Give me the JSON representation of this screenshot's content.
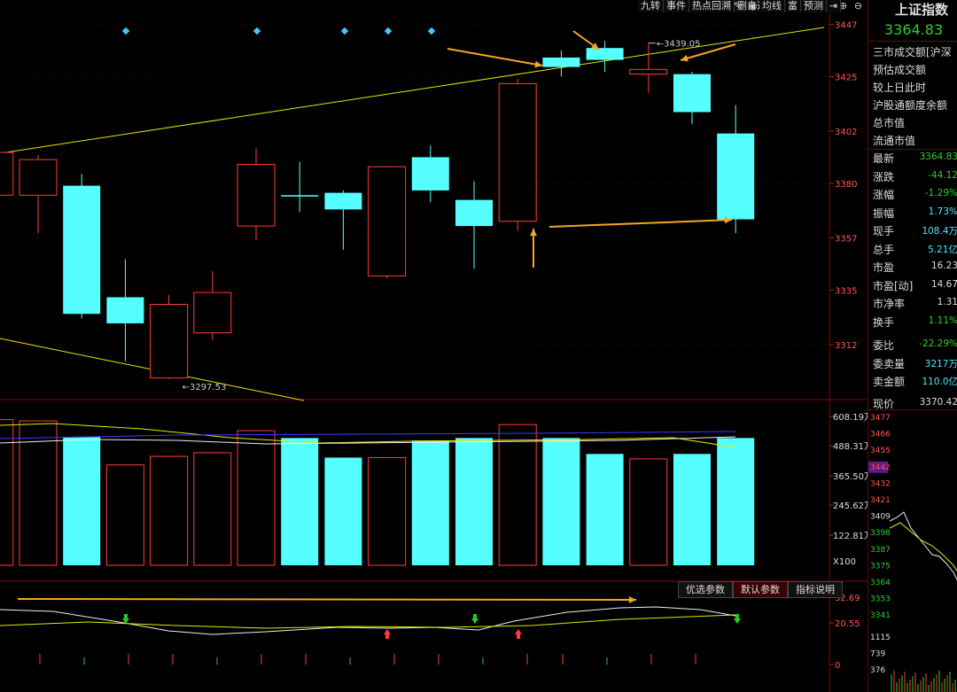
{
  "toolbar": {
    "items": [
      "九转",
      "事件",
      "热点回溯",
      "删自选",
      "均线",
      "富",
      "预测"
    ],
    "icons": [
      "pen-icon",
      "eye-icon",
      "hand-icon",
      "dotted-icon",
      "scissors-icon",
      "lock-icon",
      "delete-icon",
      "zoom-in-icon",
      "zoom-out-icon"
    ]
  },
  "right_panel": {
    "title": "上证指数",
    "price": "3364.83",
    "labels_top": [
      "三市成交额[沪深",
      "预估成交额",
      "较上日此时",
      "沪股通额度余额",
      "总市值",
      "流通市值"
    ],
    "quote_rows": [
      {
        "label": "最新",
        "value": "3364.83",
        "color": "green"
      },
      {
        "label": "涨跌",
        "value": "-44.12",
        "color": "green"
      },
      {
        "label": "涨幅",
        "value": "-1.29%",
        "color": "green"
      },
      {
        "label": "振幅",
        "value": "1.73%",
        "color": "cyan"
      },
      {
        "label": "现手",
        "value": "108.4万",
        "color": "cyan"
      },
      {
        "label": "总手",
        "value": "5.21亿",
        "color": "cyan"
      },
      {
        "label": "市盈",
        "value": "16.23",
        "color": "white"
      },
      {
        "label": "市盈[动]",
        "value": "14.67",
        "color": "white"
      },
      {
        "label": "市净率",
        "value": "1.31",
        "color": "white"
      },
      {
        "label": "换手",
        "value": "1.11%",
        "color": "green"
      },
      {
        "label": "委比",
        "value": "-22.29%",
        "color": "green"
      },
      {
        "label": "委卖量",
        "value": "3217万",
        "color": "cyan"
      },
      {
        "label": "卖金额",
        "value": "110.0亿",
        "color": "cyan"
      },
      {
        "label": "现价",
        "value": "3370.42",
        "color": "white"
      }
    ],
    "mini_axis": [
      "3477",
      "3466",
      "3455",
      "3442",
      "3432",
      "3421",
      "3409",
      "3398",
      "3387",
      "3375",
      "3364",
      "3353",
      "3341",
      "1115",
      "739",
      "376"
    ]
  },
  "param_tabs": [
    "优选参数",
    "默认参数",
    "指标说明"
  ],
  "colors": {
    "up": "#ff3b3b",
    "down": "#55ffff",
    "ma": "#e6e600",
    "arrow": "#f5a623"
  },
  "chart_data": [
    {
      "type": "candlestick",
      "price_axis_ticks": [
        "3447",
        "3425",
        "3402",
        "3380",
        "3357",
        "3335",
        "3312"
      ],
      "ylim": [
        3290,
        3452
      ],
      "annotations": [
        "3439.05",
        "3297.53"
      ],
      "candles": [
        {
          "o": 3375.0,
          "h": 3403.0,
          "l": 3357.0,
          "c": 3393.0,
          "dir": "up"
        },
        {
          "o": 3390.0,
          "h": 3392.0,
          "l": 3359.0,
          "c": 3375.0,
          "dir": "up"
        },
        {
          "o": 3379.0,
          "h": 3384.0,
          "l": 3323.0,
          "c": 3325.0,
          "dir": "down"
        },
        {
          "o": 3332.0,
          "h": 3348.0,
          "l": 3305.0,
          "c": 3321.0,
          "dir": "down"
        },
        {
          "o": 3298.0,
          "h": 3333.0,
          "l": 3297.53,
          "c": 3329.0,
          "dir": "up"
        },
        {
          "o": 3317.0,
          "h": 3343.0,
          "l": 3314.0,
          "c": 3334.0,
          "dir": "up"
        },
        {
          "o": 3362.0,
          "h": 3395.0,
          "l": 3356.0,
          "c": 3388.0,
          "dir": "up"
        },
        {
          "o": 3375.0,
          "h": 3389.0,
          "l": 3368.0,
          "c": 3375.0,
          "dir": "down"
        },
        {
          "o": 3376.0,
          "h": 3377.0,
          "l": 3352.0,
          "c": 3369.0,
          "dir": "down"
        },
        {
          "o": 3341.0,
          "h": 3387.0,
          "l": 3340.0,
          "c": 3387.0,
          "dir": "up"
        },
        {
          "o": 3391.0,
          "h": 3396.0,
          "l": 3372.0,
          "c": 3377.0,
          "dir": "down"
        },
        {
          "o": 3373.0,
          "h": 3381.0,
          "l": 3344.0,
          "c": 3362.0,
          "dir": "down"
        },
        {
          "o": 3364.0,
          "h": 3424.0,
          "l": 3360.0,
          "c": 3422.0,
          "dir": "up"
        },
        {
          "o": 3433.0,
          "h": 3436.0,
          "l": 3425.0,
          "c": 3429.0,
          "dir": "down"
        },
        {
          "o": 3437.0,
          "h": 3440.0,
          "l": 3427.0,
          "c": 3432.0,
          "dir": "down"
        },
        {
          "o": 3426.0,
          "h": 3439.05,
          "l": 3418.0,
          "c": 3428.0,
          "dir": "up"
        },
        {
          "o": 3426.0,
          "h": 3427.0,
          "l": 3405.0,
          "c": 3410.0,
          "dir": "down"
        },
        {
          "o": 3401.0,
          "h": 3413.0,
          "l": 3359.0,
          "c": 3364.83,
          "dir": "down"
        }
      ]
    },
    {
      "type": "bar",
      "volume_axis_ticks": [
        "608.19万",
        "488.31万",
        "365.50万",
        "245.62万",
        "122.81万",
        "X100"
      ],
      "ylim": [
        0,
        608.19
      ],
      "values": [
        595,
        590,
        525,
        410,
        445,
        460,
        550,
        520,
        440,
        440,
        510,
        520,
        575,
        520,
        455,
        435,
        455,
        520
      ],
      "dirs": [
        "up",
        "up",
        "down",
        "up",
        "up",
        "up",
        "up",
        "down",
        "down",
        "up",
        "down",
        "down",
        "up",
        "down",
        "down",
        "up",
        "down",
        "down"
      ]
    },
    {
      "type": "line",
      "indicator_axis_ticks": [
        "32.69",
        "20.55",
        "0"
      ]
    }
  ]
}
